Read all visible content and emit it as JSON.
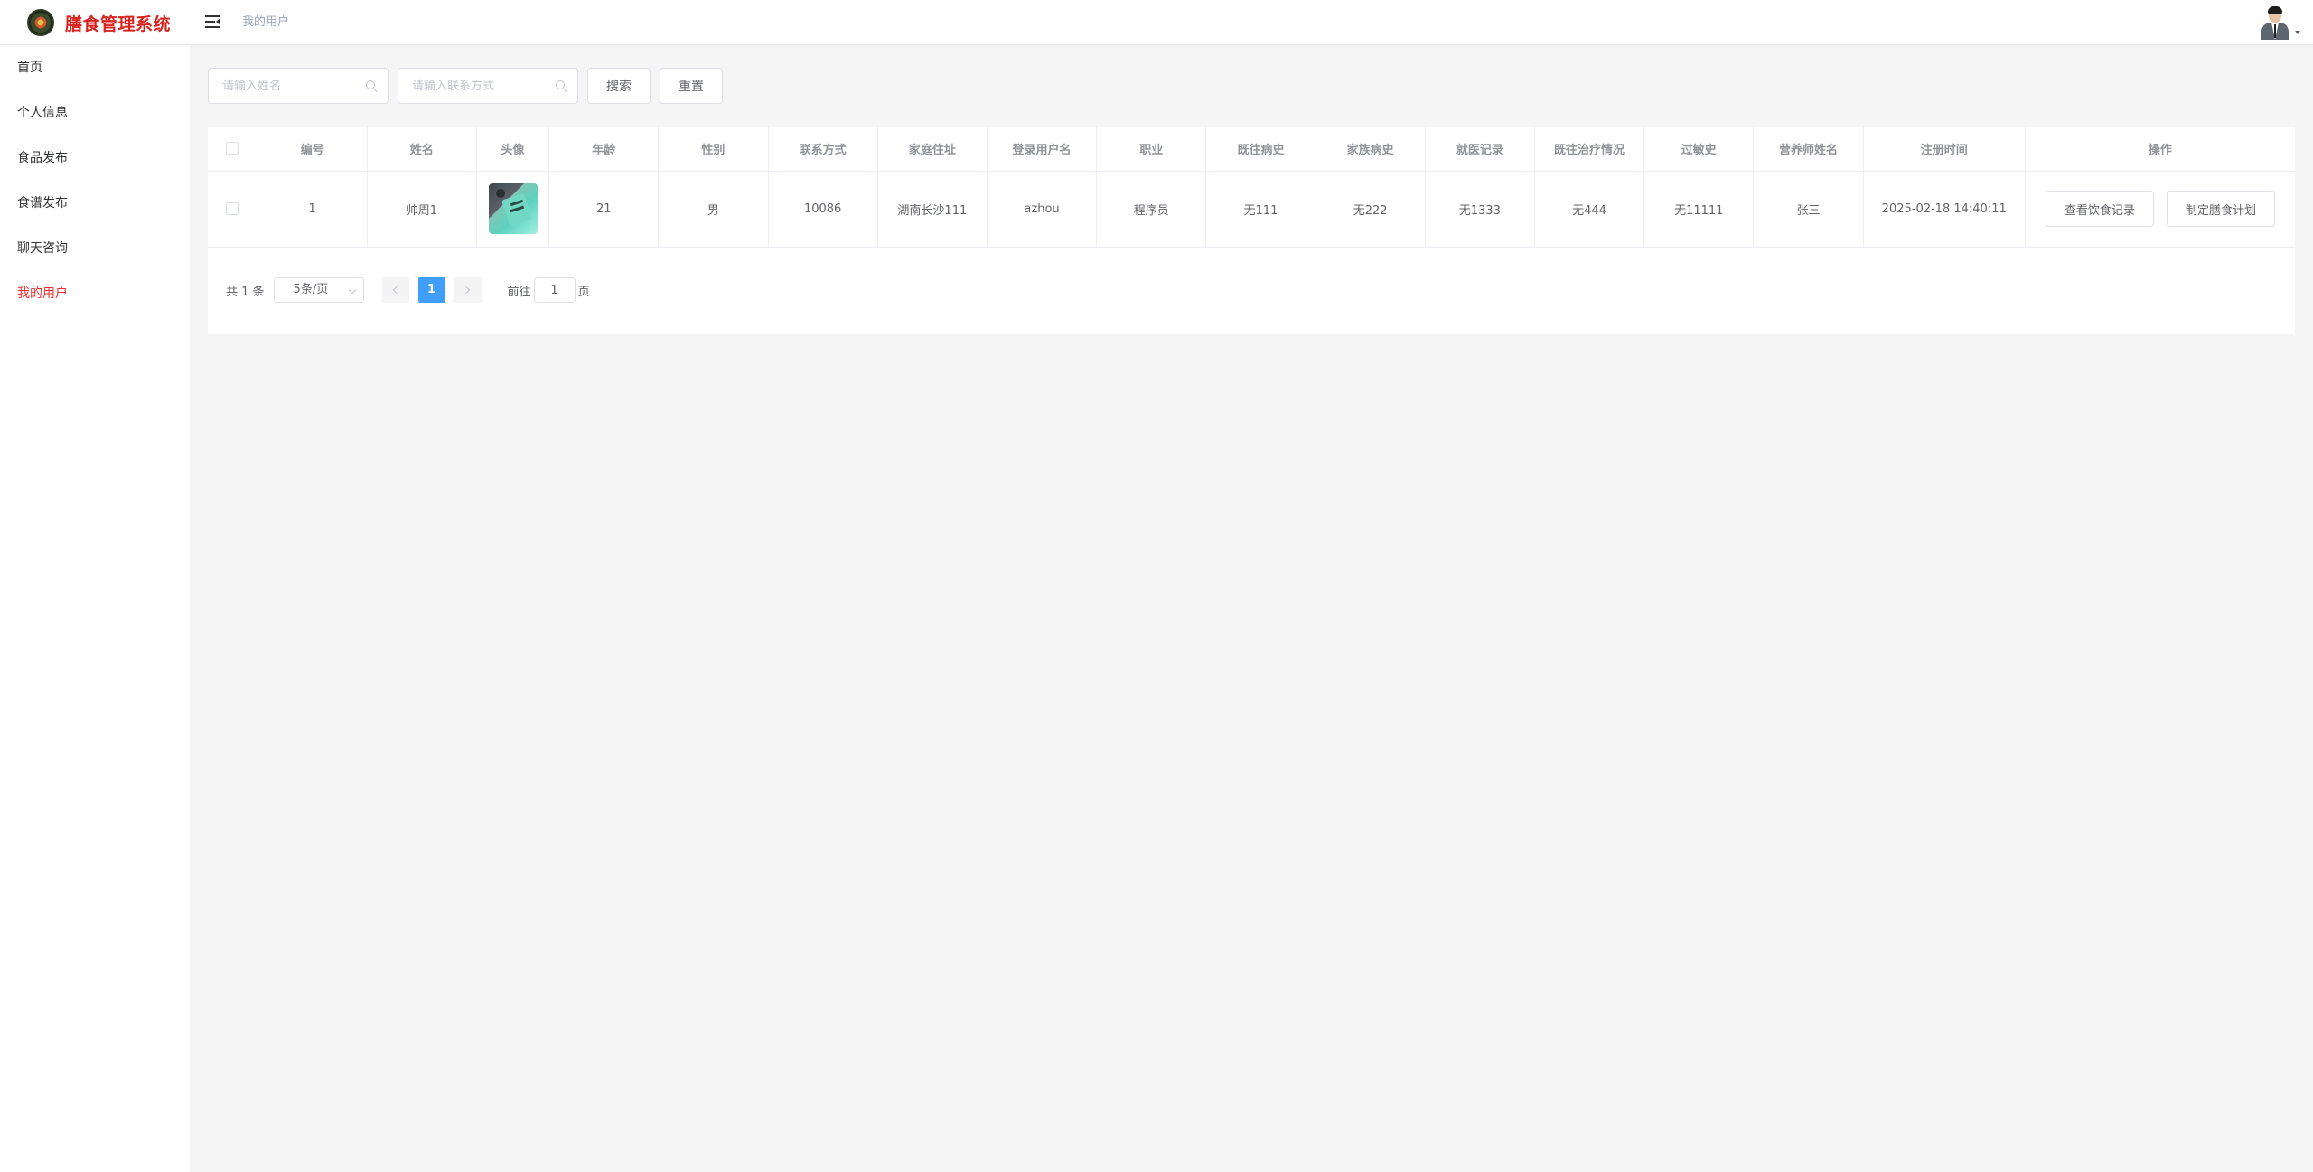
{
  "app": {
    "title": "膳食管理系统"
  },
  "header": {
    "breadcrumb": "我的用户"
  },
  "sidebar": {
    "items": [
      {
        "label": "首页"
      },
      {
        "label": "个人信息"
      },
      {
        "label": "食品发布"
      },
      {
        "label": "食谱发布"
      },
      {
        "label": "聊天咨询"
      },
      {
        "label": "我的用户",
        "active": true
      }
    ]
  },
  "search": {
    "name_placeholder": "请输入姓名",
    "contact_placeholder": "请输入联系方式",
    "search_label": "搜索",
    "reset_label": "重置"
  },
  "table": {
    "columns": [
      "编号",
      "姓名",
      "头像",
      "年龄",
      "性别",
      "联系方式",
      "家庭住址",
      "登录用户名",
      "职业",
      "既往病史",
      "家族病史",
      "就医记录",
      "既往治疗情况",
      "过敏史",
      "营养师姓名",
      "注册时间",
      "操作"
    ],
    "rows": [
      {
        "id": "1",
        "name": "帅周1",
        "avatar": "user-photo",
        "age": "21",
        "gender": "男",
        "contact": "10086",
        "address": "湖南长沙111",
        "username": "azhou",
        "job": "程序员",
        "past_history": "无111",
        "family_history": "无222",
        "medical_record": "无1333",
        "past_treatment": "无444",
        "allergy": "无11111",
        "dietitian": "张三",
        "registered": "2025-02-18 14:40:11",
        "actions": [
          "查看饮食记录",
          "制定膳食计划"
        ]
      }
    ]
  },
  "pagination": {
    "total": "共 1 条",
    "page_size": "5条/页",
    "current": "1",
    "goto_prefix": "前往",
    "goto_value": "1",
    "goto_suffix": "页"
  },
  "colors": {
    "brand": "#d9221d",
    "active_menu": "#f5302c",
    "primary": "#409eff"
  }
}
